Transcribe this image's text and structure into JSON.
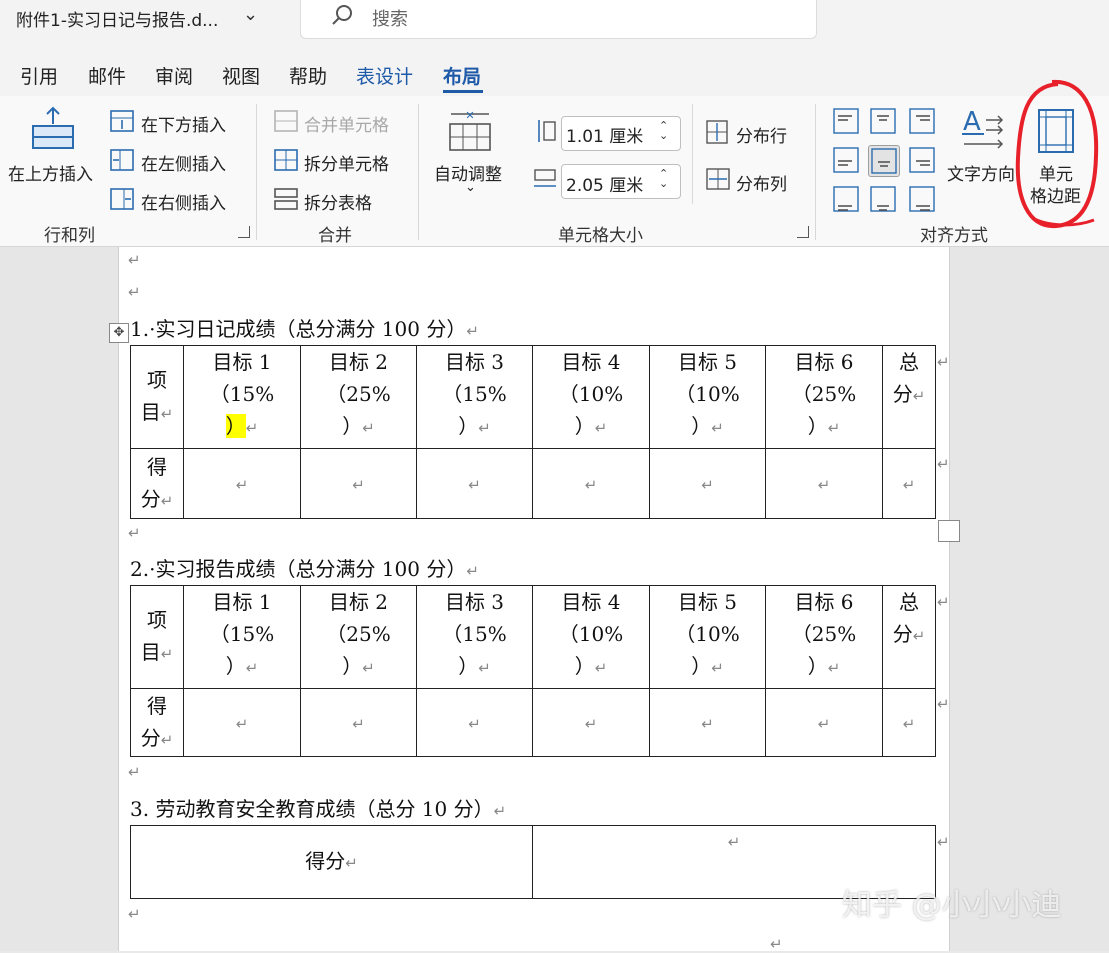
{
  "window": {
    "doc_title": "附件1-实习日记与报告.d...",
    "search_placeholder": "搜索"
  },
  "tabs": [
    "引用",
    "邮件",
    "审阅",
    "视图",
    "帮助",
    "表设计",
    "布局"
  ],
  "ribbon": {
    "rows_cols": {
      "insert_above": "在上方插入",
      "insert_below": "在下方插入",
      "insert_left": "在左侧插入",
      "insert_right": "在右侧插入",
      "group": "行和列"
    },
    "merge": {
      "merge_cells": "合并单元格",
      "split_cells": "拆分单元格",
      "split_table": "拆分表格",
      "group": "合并"
    },
    "cell_size": {
      "autofit": "自动调整",
      "height": "1.01 厘米",
      "width": "2.05 厘米",
      "distribute_rows": "分布行",
      "distribute_cols": "分布列",
      "group": "单元格大小"
    },
    "alignment": {
      "text_direction": "文字方向",
      "cell_margins_line1": "单元",
      "cell_margins_line2": "格边距",
      "group": "对齐方式"
    }
  },
  "document": {
    "heading1": "1.·实习日记成绩（总分满分 100 分）",
    "heading2": "2.·实习报告成绩（总分满分 100 分）",
    "heading3": "3. 劳动教育安全教育成绩（总分 10 分）",
    "row_label_item": [
      "项",
      "目"
    ],
    "row_label_score": [
      "得",
      "分"
    ],
    "goals": [
      {
        "name": "目标 1",
        "pct": "（15%",
        "close": "）"
      },
      {
        "name": "目标 2",
        "pct": "（25%",
        "close": "）"
      },
      {
        "name": "目标 3",
        "pct": "（15%",
        "close": "）"
      },
      {
        "name": "目标 4",
        "pct": "（10%",
        "close": "）"
      },
      {
        "name": "目标 5",
        "pct": "（10%",
        "close": "）"
      },
      {
        "name": "目标 6",
        "pct": "（25%",
        "close": "）"
      }
    ],
    "total": [
      "总",
      "分"
    ],
    "table3_label": "得分",
    "return_mark": "↵"
  },
  "watermark": "知乎 @小小小迪"
}
